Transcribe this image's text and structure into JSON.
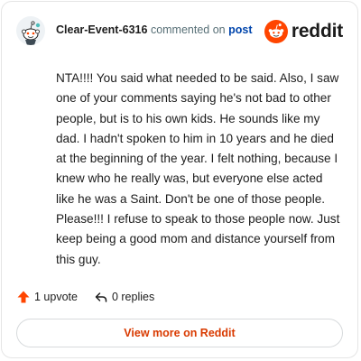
{
  "header": {
    "username": "Clear-Event-6316",
    "action_text": "commented on",
    "post_link_label": "post",
    "brand_name": "reddit"
  },
  "comment": {
    "body": "NTA!!!! You said what needed to be said. Also, I saw one of your comments saying he's not bad to other people, but is to his own kids. He sounds like my dad. I hadn't spoken to him in 10 years and he died at the beginning of the year. I felt nothing, because I knew who he really was, but everyone else acted like he was a Saint. Don't be one of those people. Please!!! I refuse to speak to those people now. Just keep being a good mom and distance yourself from this guy."
  },
  "stats": {
    "upvotes_label": "1 upvote",
    "replies_label": "0 replies"
  },
  "cta": {
    "label": "View more on Reddit"
  },
  "colors": {
    "accent": "#ff4500",
    "cta_text": "#d93a00",
    "link": "#0045ac",
    "muted": "#576f76"
  },
  "icons": {
    "avatar": "snoo-avatar",
    "brand": "reddit-snoo-logo",
    "upvote": "upvote-arrow-icon",
    "reply": "reply-icon"
  }
}
